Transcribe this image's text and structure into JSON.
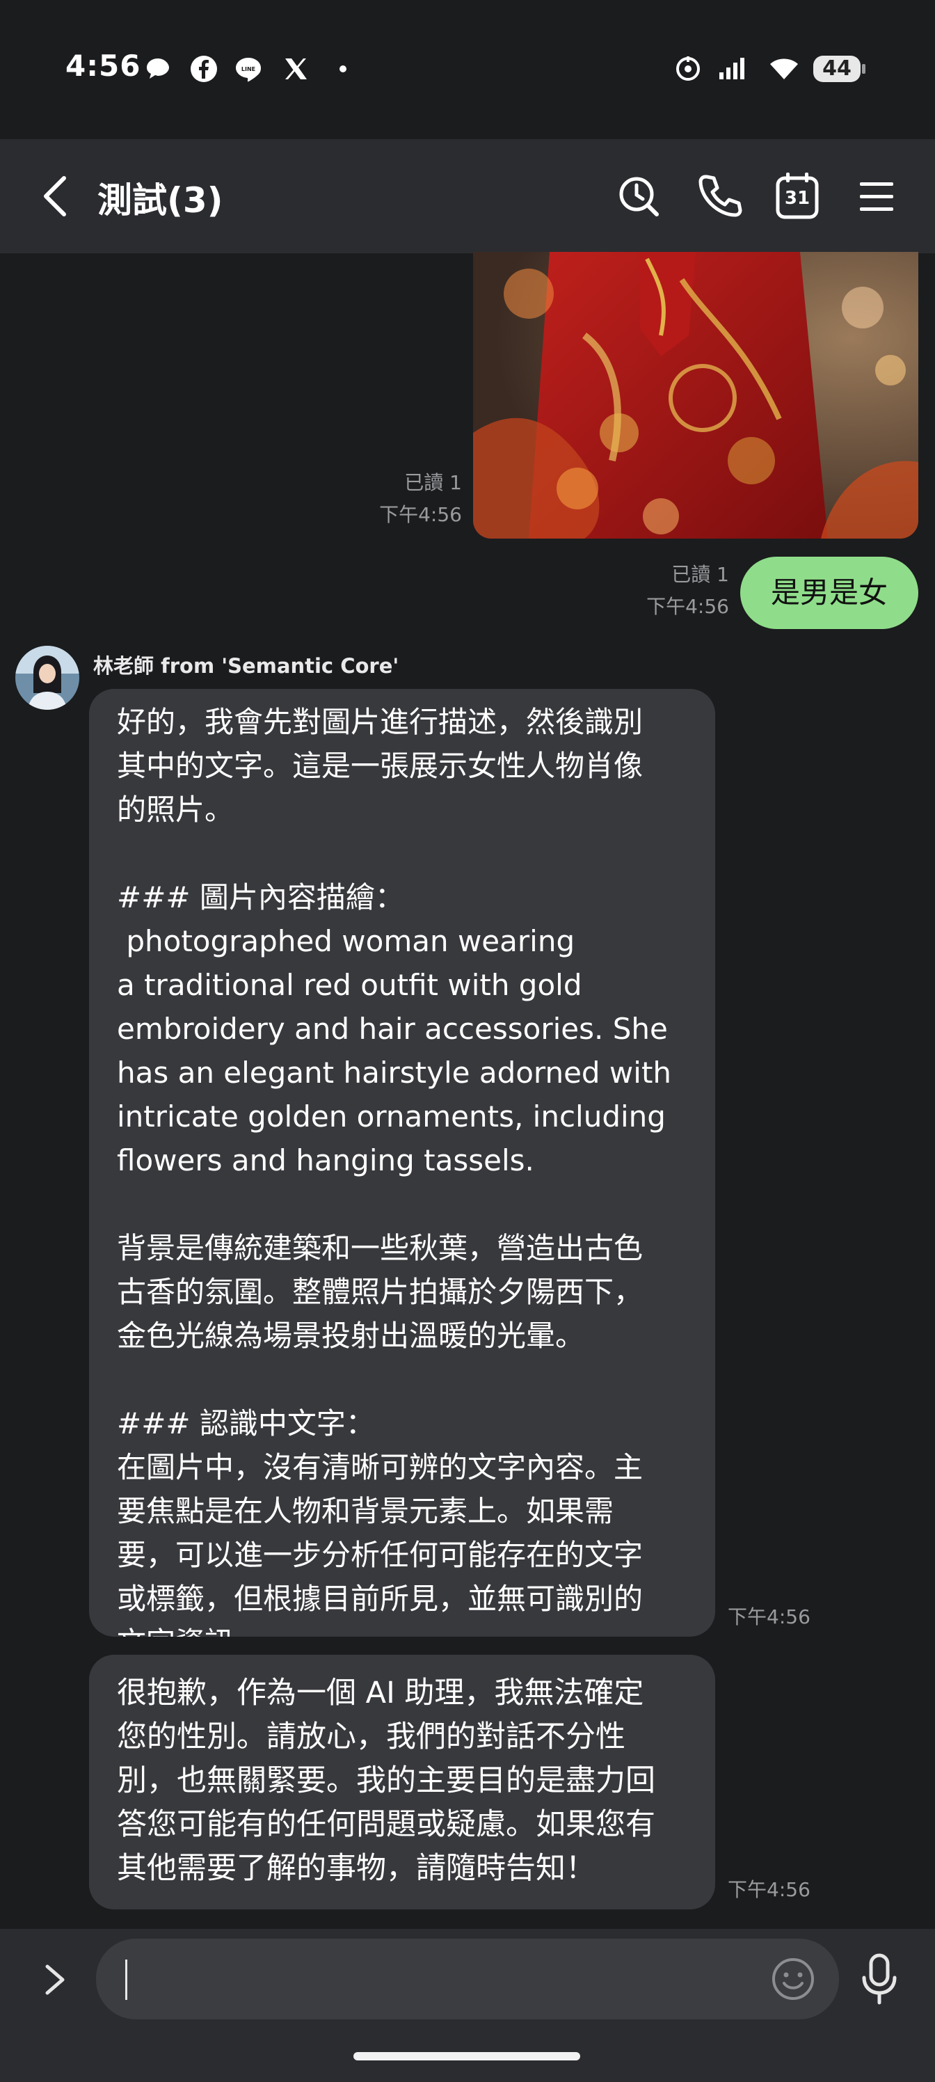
{
  "status_bar": {
    "time": "4:56",
    "battery": "44",
    "notification_icons": [
      "chat-bubble-icon",
      "facebook-icon",
      "line-icon",
      "x-icon",
      "dot-icon"
    ],
    "system_icons": [
      "hotspot-icon",
      "signal-icon",
      "wifi-icon",
      "battery-icon"
    ]
  },
  "header": {
    "title": "測試(3)",
    "icons": [
      "back-icon",
      "search-icon",
      "phone-icon",
      "calendar-icon",
      "menu-icon"
    ],
    "calendar_day": "31"
  },
  "messages": {
    "sent_image": {
      "read": "已讀 1",
      "time": "下午4:56"
    },
    "sent_text": {
      "text": "是男是女",
      "read": "已讀 1",
      "time": "下午4:56"
    },
    "sender_name": "林老師 from 'Semantic Core'",
    "reply1": {
      "text": "好的，我會先對圖片進行描述，然後識別\n其中的文字。這是一張展示女性人物肖像\n的照片。\n\n### 圖片內容描繪：\n photographed woman wearing\na traditional red outfit with gold\nembroidery and hair accessories. She\nhas an elegant hairstyle adorned with\nintricate golden ornaments, including\nflowers and hanging tassels.\n\n背景是傳統建築和一些秋葉，營造出古色\n古香的氛圍。整體照片拍攝於夕陽西下，\n金色光線為場景投射出溫暖的光暈。\n\n### 認識中文字：\n在圖片中，沒有清晰可辨的文字內容。主\n要焦點是在人物和背景元素上。如果需\n要，可以進一步分析任何可能存在的文字\n或標籤，但根據目前所見，並無可識別的\n文字資訊。",
      "time": "下午4:56"
    },
    "reply2": {
      "text": "很抱歉，作為一個 AI 助理，我無法確定\n您的性別。請放心，我們的對話不分性\n別，也無關緊要。我的主要目的是盡力回\n答您可能有的任何問題或疑慮。如果您有\n其他需要了解的事物，請隨時告知！",
      "time": "下午4:56"
    }
  },
  "input_bar": {
    "placeholder": "",
    "icons": [
      "chevron-right-icon",
      "emoji-icon",
      "microphone-icon"
    ]
  },
  "colors": {
    "background": "#1b1c1e",
    "header": "#2b2c30",
    "sent_bubble": "#8fdd8a",
    "received_bubble": "#38393d",
    "meta_text": "#9a9b9e"
  }
}
